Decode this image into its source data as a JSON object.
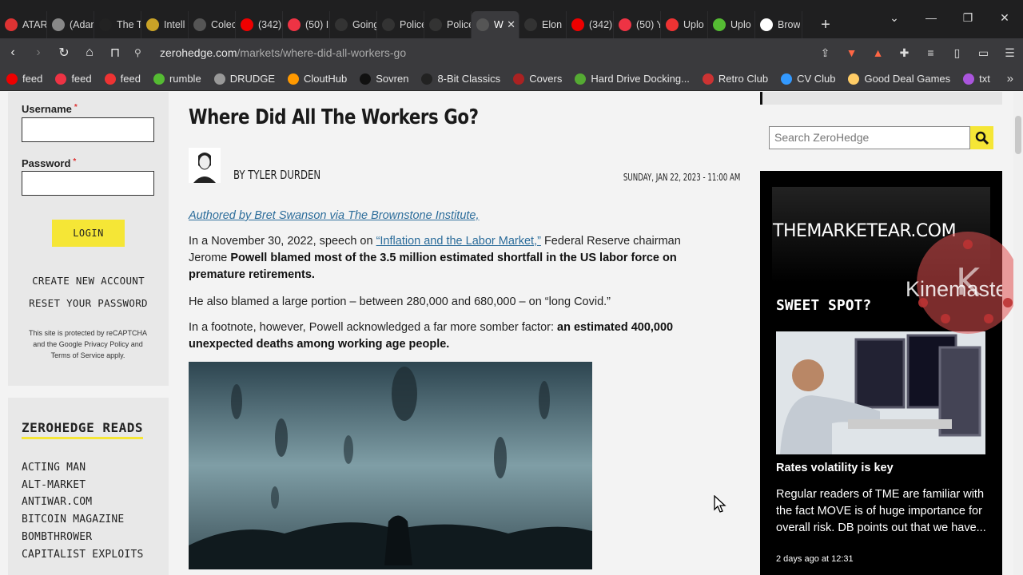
{
  "tabs": [
    {
      "title": "ATAR",
      "color": "#d33"
    },
    {
      "title": "(Adar",
      "color": "#888"
    },
    {
      "title": "The T",
      "color": "#222"
    },
    {
      "title": "Intell",
      "color": "#c9a227"
    },
    {
      "title": "Colec",
      "color": "#555"
    },
    {
      "title": "(342)",
      "color": "#e00"
    },
    {
      "title": "(50) I",
      "color": "#e34"
    },
    {
      "title": "Going",
      "color": "#333"
    },
    {
      "title": "Police",
      "color": "#333"
    },
    {
      "title": "Police",
      "color": "#333"
    },
    {
      "title": "W",
      "color": "#555"
    },
    {
      "title": "Elon",
      "color": "#333"
    },
    {
      "title": "(342)",
      "color": "#e00"
    },
    {
      "title": "(50) Y",
      "color": "#e34"
    },
    {
      "title": "Uplo",
      "color": "#e33"
    },
    {
      "title": "Uplo",
      "color": "#5b3"
    },
    {
      "title": "Brow",
      "color": "#fff"
    }
  ],
  "address": {
    "host": "zerohedge.com",
    "path": "/markets/where-did-all-workers-go"
  },
  "badges": {
    "brave": "7",
    "alert": "1"
  },
  "bookmarks": [
    {
      "label": "feed",
      "color": "#e00"
    },
    {
      "label": "feed",
      "color": "#e34"
    },
    {
      "label": "feed",
      "color": "#e33"
    },
    {
      "label": "rumble",
      "color": "#5b3"
    },
    {
      "label": "DRUDGE",
      "color": "#999"
    },
    {
      "label": "CloutHub",
      "color": "#f90"
    },
    {
      "label": "Sovren",
      "color": "#111"
    },
    {
      "label": "8-Bit Classics",
      "color": "#222"
    },
    {
      "label": "Covers",
      "color": "#a22"
    },
    {
      "label": "Hard Drive Docking...",
      "color": "#5a3"
    },
    {
      "label": "Retro Club",
      "color": "#c33"
    },
    {
      "label": "CV Club",
      "color": "#39f"
    },
    {
      "label": "Good Deal Games",
      "color": "#fc6"
    },
    {
      "label": "txt",
      "color": "#a5d"
    }
  ],
  "login": {
    "username_label": "Username",
    "password_label": "Password",
    "required_mark": "*",
    "login_button": "LOGIN",
    "create_account": "CREATE NEW ACCOUNT",
    "reset_password": "RESET YOUR PASSWORD",
    "captcha_note": "This site is protected by reCAPTCHA and the Google Privacy Policy and Terms of Service apply."
  },
  "reads": {
    "title": "ZEROHEDGE READS",
    "items": [
      "ACTING MAN",
      "ALT-MARKET",
      "ANTIWAR.COM",
      "BITCOIN MAGAZINE",
      "BOMBTHROWER",
      "CAPITALIST EXPLOITS"
    ]
  },
  "article": {
    "title": "Where Did All The Workers Go?",
    "byline": "BY TYLER DURDEN",
    "date": "SUNDAY, JAN 22, 2023 - 11:00 AM",
    "attribution": "Authored by Bret Swanson via The Brownstone Institute,",
    "p1_a": "In a November 30, 2022, speech on ",
    "p1_link": "“Inflation and the Labor Market,”",
    "p1_b": " Federal Reserve chairman Jerome ",
    "p1_bold": "Powell blamed most of the 3.5 million estimated shortfall in the US labor force on premature retirements.",
    "p2": "He also blamed a large portion – between 280,000 and 680,000 – on “long Covid.”",
    "p3_a": "In a footnote, however, Powell acknowledged a far more somber factor: ",
    "p3_bold": "an estimated 400,000 unexpected deaths among working age people."
  },
  "sidebar": {
    "search_placeholder": "Search ZeroHedge",
    "ad_brand": "THEMARKETEAR.COM",
    "ad_heading": "SWEET SPOT?",
    "ad_subtitle": "Rates volatility is key",
    "ad_text": "Regular readers of TME are familiar with the fact MOVE is of huge importance for overall risk. DB points out that we have...",
    "ad_time": "2 days ago at 12:31",
    "watermark": "Kinemaster"
  }
}
